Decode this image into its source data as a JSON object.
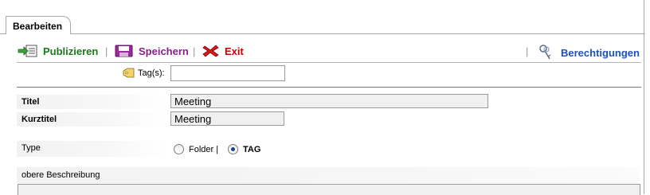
{
  "tab": {
    "label": "Bearbeiten"
  },
  "toolbar": {
    "publish_label": "Publizieren",
    "save_label": "Speichern",
    "exit_label": "Exit",
    "separator": "|",
    "permissions_label": "Berechtigungen",
    "colors": {
      "publish": "#1a7a1a",
      "save": "#8a1f8a",
      "exit": "#cc0000",
      "permissions": "#1d4fc4"
    }
  },
  "form": {
    "tags": {
      "label": "Tag(s):",
      "value": ""
    },
    "title": {
      "label": "Titel",
      "value": "Meeting"
    },
    "short_title": {
      "label": "Kurztitel",
      "value": "Meeting"
    },
    "type": {
      "label": "Type",
      "options": [
        {
          "label": "Folder |",
          "selected": false
        },
        {
          "label": "TAG",
          "selected": true
        }
      ]
    },
    "upper_description": {
      "label": "obere Beschreibung"
    }
  }
}
